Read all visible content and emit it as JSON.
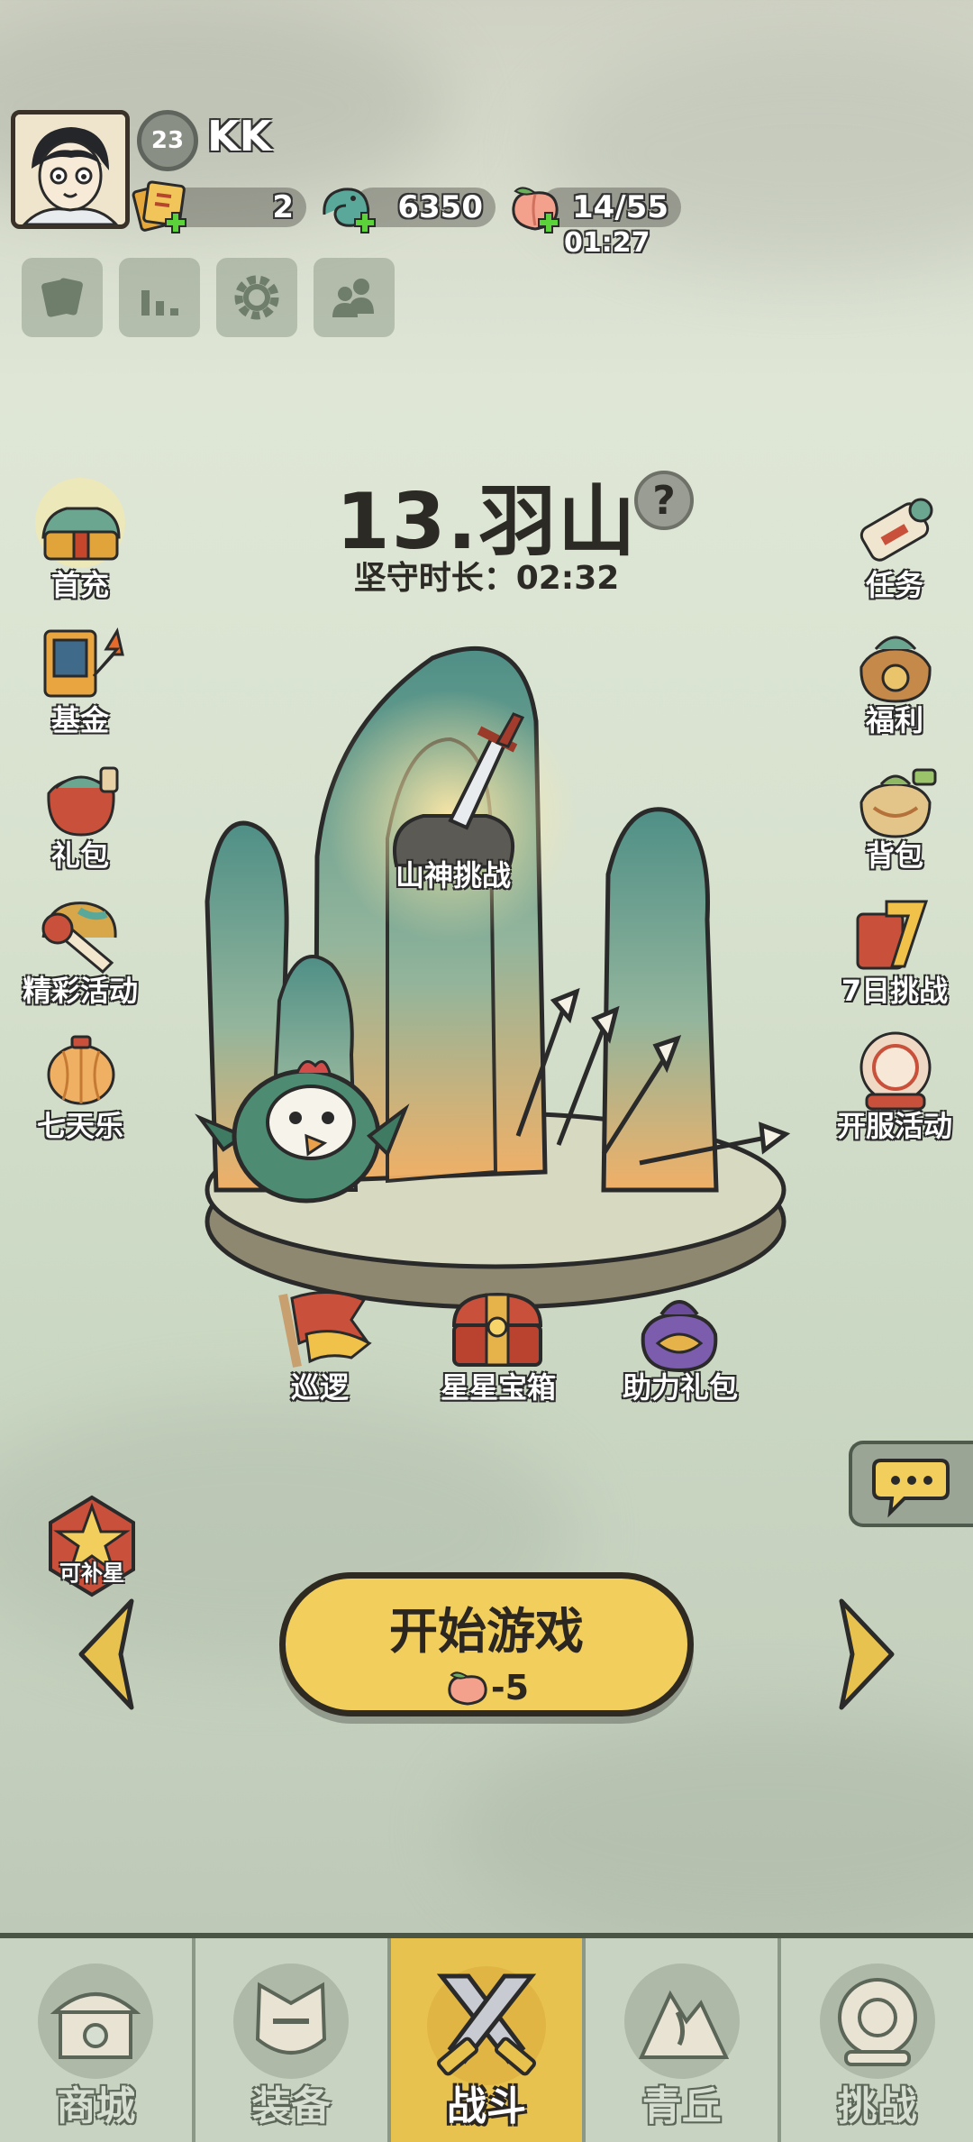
{
  "player": {
    "level": "23",
    "name": "KK"
  },
  "resources": {
    "tickets": "2",
    "jade": "6350",
    "stamina": "14/55",
    "stamina_timer": "01:27"
  },
  "stage": {
    "title": "13.羽山",
    "help": "?",
    "guard_time": "坚守时长：02:32",
    "boss_label": "山神挑战"
  },
  "left_menu": [
    {
      "label": "首充",
      "icon": "first-recharge-icon"
    },
    {
      "label": "基金",
      "icon": "fund-icon"
    },
    {
      "label": "礼包",
      "icon": "gift-pack-icon"
    },
    {
      "label": "精彩活动",
      "icon": "events-icon"
    },
    {
      "label": "七天乐",
      "icon": "seven-days-icon"
    }
  ],
  "right_menu": [
    {
      "label": "任务",
      "icon": "quest-scroll-icon"
    },
    {
      "label": "福利",
      "icon": "welfare-bag-icon"
    },
    {
      "label": "背包",
      "icon": "backpack-icon"
    },
    {
      "label": "7日挑战",
      "icon": "seven-day-challenge-icon"
    },
    {
      "label": "开服活动",
      "icon": "server-open-icon"
    }
  ],
  "scene_buttons": {
    "patrol": "巡逻",
    "star_chest": "星星宝箱",
    "assist_pack": "助力礼包"
  },
  "star_badge": "可补星",
  "start": {
    "label": "开始游戏",
    "cost": "-5"
  },
  "nav": [
    {
      "label": "商城",
      "icon": "shop-icon"
    },
    {
      "label": "装备",
      "icon": "equipment-icon"
    },
    {
      "label": "战斗",
      "icon": "battle-icon",
      "active": true
    },
    {
      "label": "青丘",
      "icon": "qingqiu-icon"
    },
    {
      "label": "挑战",
      "icon": "challenge-icon"
    }
  ],
  "colors": {
    "accent": "#f2cf5c",
    "nav_active": "#e8c24f",
    "outline": "#2e2a22",
    "mountain_teal": "#4f8f86"
  }
}
